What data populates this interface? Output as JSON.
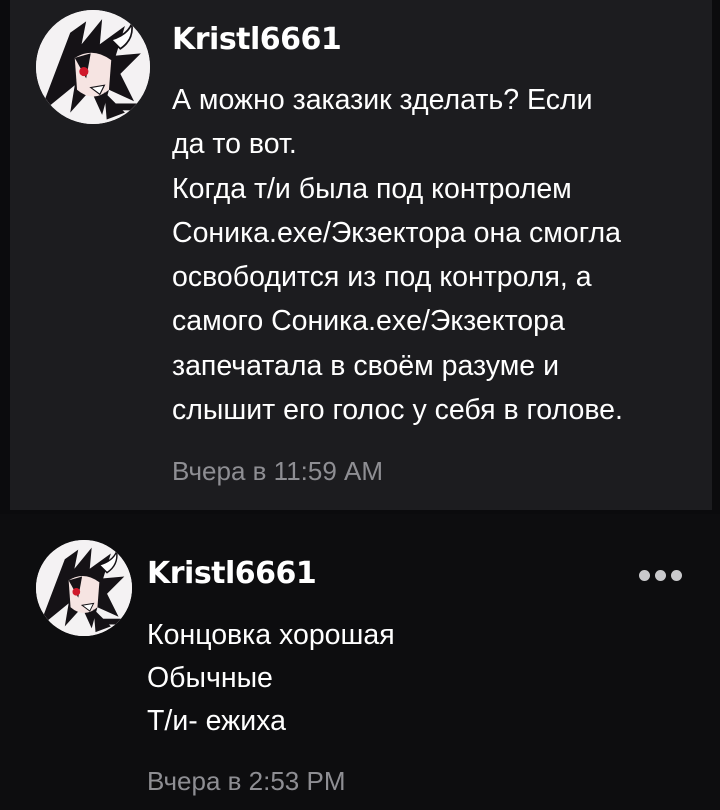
{
  "comments": [
    {
      "username": "Kristl6661",
      "avatar_icon": "anime-character-avatar",
      "lines": [
        "А можно заказик зделать? Если",
        "да то вот.",
        "Когда т/и была под контролем",
        "Соника.exe/Экзектора она смогла",
        "освободится из под контроля, а",
        "самого Соника.exe/Экзектора",
        "запечатала в своём разуме и",
        "слышит его голос у себя в голове."
      ],
      "timestamp": "Вчера в 11:59 AM"
    },
    {
      "username": "Kristl6661",
      "avatar_icon": "anime-character-avatar",
      "lines": [
        "Концовка хорошая",
        "Обычные",
        "Т/и- ежиха"
      ],
      "timestamp": "Вчера в 2:53 PM",
      "more_icon": "more-options-icon"
    }
  ],
  "colors": {
    "background": "#0b0b0d",
    "highlighted_card": "#1c1c1f",
    "text": "#ffffff",
    "timestamp": "#8e8e93",
    "more_dots": "#c9c9cc"
  }
}
